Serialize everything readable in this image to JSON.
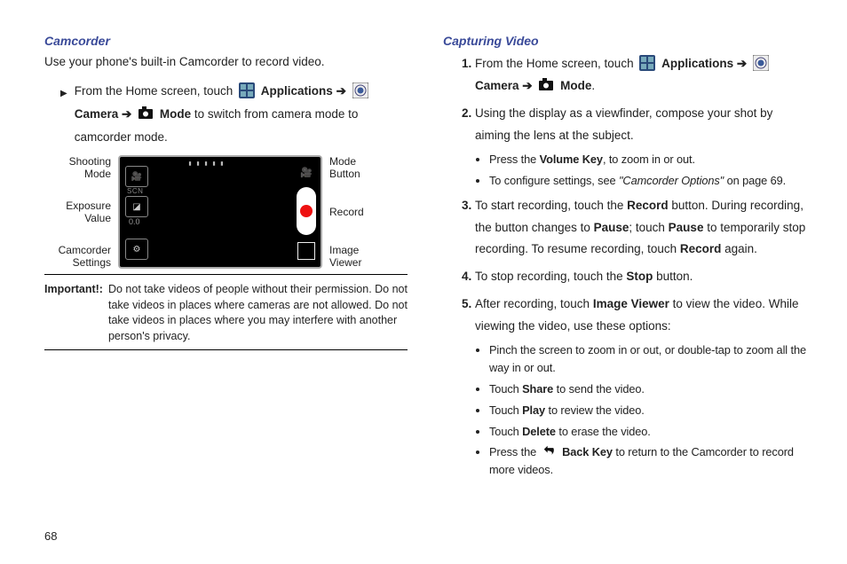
{
  "left": {
    "heading": "Camcorder",
    "intro": "Use your phone's built-in Camcorder to record video.",
    "step_from": "From the Home screen, touch ",
    "applications": "Applications",
    "arrow": " ➔ ",
    "camera": "Camera",
    "mode": "Mode",
    "step_tail": " to switch from camera mode to camcorder mode.",
    "diagram": {
      "left_labels": [
        "Shooting\nMode",
        "Exposure\nValue",
        "Camcorder\nSettings"
      ],
      "right_labels": [
        "Mode\nButton",
        "Record",
        "Image\nViewer"
      ],
      "scn": "SCN",
      "ev": "0.0"
    },
    "important_label": "Important!:",
    "important_text": "Do not take videos of people without their permission. Do not take videos in places where cameras are not allowed. Do not take videos in places where you may interfere with another person's privacy."
  },
  "right": {
    "heading": "Capturing Video",
    "s1_from": "From the Home screen, touch ",
    "applications": "Applications",
    "arrow": " ➔ ",
    "camera": "Camera",
    "mode": "Mode",
    "s1_period": ".",
    "s2": "Using the display as a viewfinder, compose your shot by aiming the lens at the subject.",
    "b2a_pre": "Press the ",
    "b2a_bold": "Volume Key",
    "b2a_post": ", to zoom in or out.",
    "b2b_pre": "To configure settings, see ",
    "b2b_em": "\"Camcorder Options\"",
    "b2b_post": " on page 69.",
    "s3_a": "To start recording, touch the ",
    "s3_record": "Record",
    "s3_b": " button. During recording, the button changes to ",
    "s3_pause": "Pause",
    "s3_c": "; touch ",
    "s3_pause2": "Pause",
    "s3_d": " to temporarily stop recording. To resume recording, touch ",
    "s3_record2": "Record",
    "s3_e": " again.",
    "s4_a": "To stop recording, touch the ",
    "s4_stop": "Stop",
    "s4_b": " button.",
    "s5_a": "After recording, touch ",
    "s5_iv": "Image Viewer",
    "s5_b": " to view the video. While viewing the video, use these options:",
    "b5a": "Pinch the screen to zoom in or out, or double-tap to zoom all the way in or out.",
    "b5b_pre": "Touch ",
    "b5b_bold": "Share",
    "b5b_post": " to send the video.",
    "b5c_pre": "Touch ",
    "b5c_bold": "Play",
    "b5c_post": " to review the video.",
    "b5d_pre": "Touch ",
    "b5d_bold": "Delete",
    "b5d_post": "  to erase the video.",
    "b5e_pre": "Press the  ",
    "b5e_bold": " Back Key ",
    "b5e_post": " to return to the Camcorder to record more videos."
  },
  "page": "68"
}
